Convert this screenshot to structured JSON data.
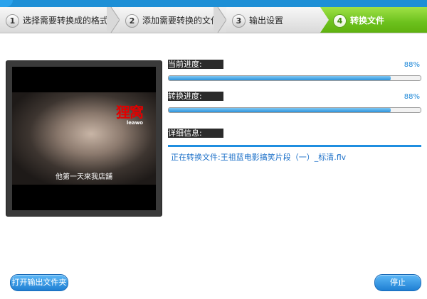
{
  "steps": [
    {
      "num": "1",
      "label": "选择需要转换成的格式"
    },
    {
      "num": "2",
      "label": "添加需要转换的文件"
    },
    {
      "num": "3",
      "label": "输出设置"
    },
    {
      "num": "4",
      "label": "转换文件"
    }
  ],
  "active_step": 4,
  "preview": {
    "logo_text": "狸窝",
    "logo_subtext": "leawo",
    "subtitle": "他第一天來我店舖"
  },
  "current_progress": {
    "label": "当前进度:",
    "percent_text": "88%",
    "value": 0.88
  },
  "convert_progress": {
    "label": "转换进度:",
    "percent_text": "88%",
    "value": 0.88
  },
  "details": {
    "label": "详细信息:",
    "message": "正在转换文件:王祖蓝电影搞笑片段（一）_标清.flv"
  },
  "buttons": {
    "open_output": "打开输出文件夹",
    "stop": "停止"
  },
  "colors": {
    "accent_blue": "#1f8ee0",
    "active_step_green": "#6cc11d",
    "logo_red": "#e10000"
  }
}
